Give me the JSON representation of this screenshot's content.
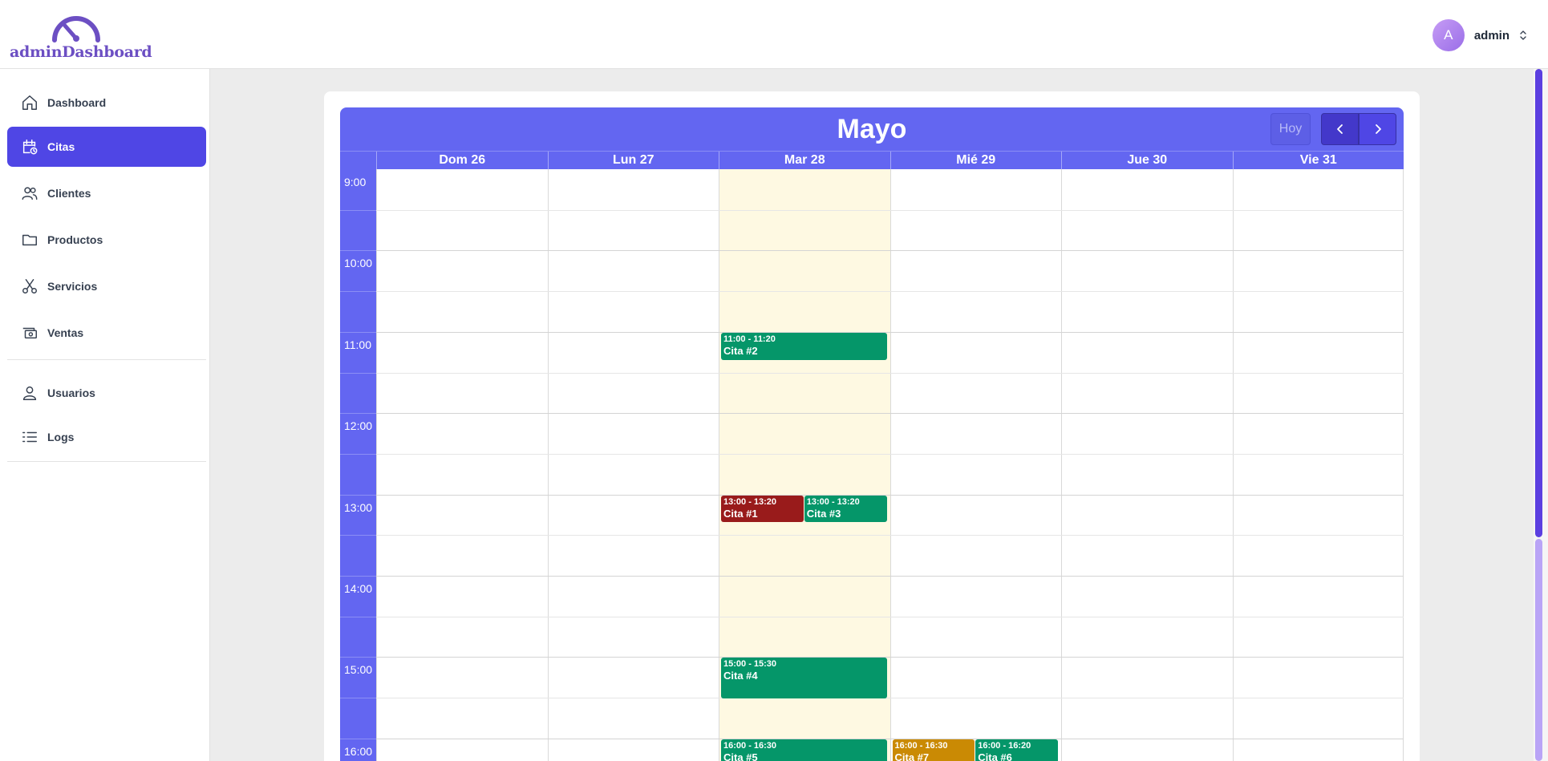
{
  "brand": {
    "name": "adminDashboard",
    "color": "#6c4fc3"
  },
  "user": {
    "initial": "A",
    "name": "admin"
  },
  "sidebar": {
    "items": [
      {
        "label": "Dashboard",
        "icon": "home-icon"
      },
      {
        "label": "Citas",
        "icon": "calendar-clock-icon",
        "active": true
      },
      {
        "label": "Clientes",
        "icon": "users-icon"
      },
      {
        "label": "Productos",
        "icon": "folder-icon"
      },
      {
        "label": "Servicios",
        "icon": "scissors-icon"
      },
      {
        "label": "Ventas",
        "icon": "cash-icon"
      },
      {
        "label": "Usuarios",
        "icon": "user-icon"
      },
      {
        "label": "Logs",
        "icon": "list-icon"
      }
    ]
  },
  "calendar": {
    "title": "Mayo",
    "today_label": "Hoy",
    "days": [
      "Dom 26",
      "Lun 27",
      "Mar 28",
      "Mié 29",
      "Jue 30",
      "Vie 31"
    ],
    "today_index": 2,
    "times": [
      "9:00",
      "10:00",
      "11:00",
      "12:00",
      "13:00",
      "14:00",
      "15:00",
      "16:00"
    ],
    "colors": {
      "header": "#6366f1",
      "today": "#fef9e2",
      "green": "#059669",
      "red": "#991b1b",
      "amber": "#ca8a04"
    },
    "events": [
      {
        "time": "11:00 - 11:20",
        "title": "Cita #2",
        "day": 2,
        "start": "11:00",
        "end": "11:20",
        "column": 0,
        "columns": 1,
        "color": "green"
      },
      {
        "time": "13:00 - 13:20",
        "title": "Cita #1",
        "day": 2,
        "start": "13:00",
        "end": "13:20",
        "column": 0,
        "columns": 2,
        "color": "red"
      },
      {
        "time": "13:00 - 13:20",
        "title": "Cita #3",
        "day": 2,
        "start": "13:00",
        "end": "13:20",
        "column": 1,
        "columns": 2,
        "color": "green"
      },
      {
        "time": "15:00 - 15:30",
        "title": "Cita #4",
        "day": 2,
        "start": "15:00",
        "end": "15:30",
        "column": 0,
        "columns": 1,
        "color": "green"
      },
      {
        "time": "16:00 - 16:30",
        "title": "Cita #5",
        "day": 2,
        "start": "16:00",
        "end": "16:30",
        "column": 0,
        "columns": 1,
        "color": "green"
      },
      {
        "time": "16:00 - 16:30",
        "title": "Cita #7",
        "day": 3,
        "start": "16:00",
        "end": "16:30",
        "column": 0,
        "columns": 2,
        "color": "amber"
      },
      {
        "time": "16:00 - 16:20",
        "title": "Cita #6",
        "day": 3,
        "start": "16:00",
        "end": "16:20",
        "column": 1,
        "columns": 2,
        "color": "green"
      }
    ]
  }
}
